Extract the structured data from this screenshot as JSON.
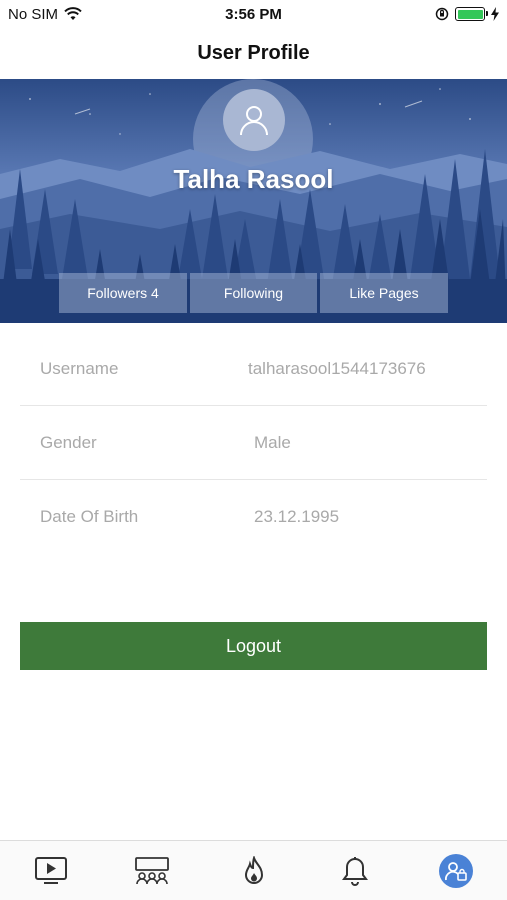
{
  "status_bar": {
    "carrier": "No SIM",
    "time": "3:56 PM"
  },
  "nav": {
    "title": "User Profile"
  },
  "profile": {
    "name": "Talha Rasool",
    "stats": [
      {
        "label": "Followers 4"
      },
      {
        "label": "Following"
      },
      {
        "label": "Like Pages"
      }
    ]
  },
  "details": [
    {
      "label": "Username",
      "value": "talharasool1544173676"
    },
    {
      "label": "Gender",
      "value": "Male"
    },
    {
      "label": "Date Of Birth",
      "value": "23.12.1995"
    }
  ],
  "logout": {
    "label": "Logout"
  },
  "tab_bar": {
    "tabs": [
      {
        "icon": "video-play-icon",
        "active": false
      },
      {
        "icon": "group-icon",
        "active": false
      },
      {
        "icon": "flame-icon",
        "active": false
      },
      {
        "icon": "bell-icon",
        "active": false
      },
      {
        "icon": "profile-icon",
        "active": true
      }
    ]
  },
  "colors": {
    "accent_green": "#3e7a3a",
    "active_tab": "#4a82d6",
    "battery": "#34c759",
    "header_dark": "#2c4b86"
  }
}
